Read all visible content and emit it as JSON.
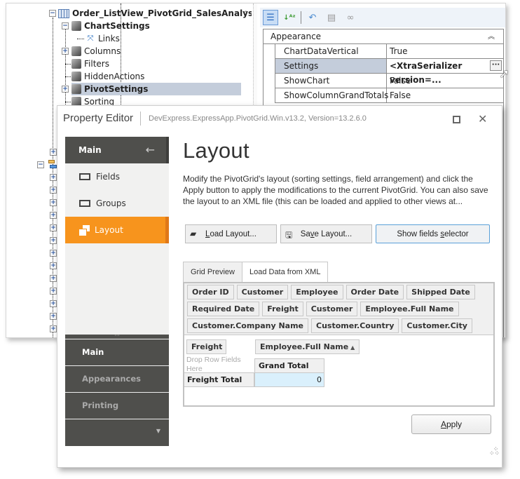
{
  "model_tree": {
    "nodes": [
      {
        "label": "Order_ListView_PivotGrid_SalesAnalysis",
        "bold": true,
        "icon": "listview-icon",
        "expander": "minus"
      },
      {
        "label": "ChartSettings",
        "bold": true,
        "icon": "cube-icon",
        "expander": "minus"
      },
      {
        "label": "Links",
        "bold": false,
        "icon": "links-icon",
        "expander": "none"
      },
      {
        "label": "Columns",
        "bold": false,
        "icon": "cube-icon",
        "expander": "plus"
      },
      {
        "label": "Filters",
        "bold": false,
        "icon": "cube-icon",
        "expander": "none"
      },
      {
        "label": "HiddenActions",
        "bold": false,
        "icon": "cube-icon",
        "expander": "none"
      },
      {
        "label": "PivotSettings",
        "bold": true,
        "icon": "cube-icon",
        "expander": "plus",
        "selected": true
      },
      {
        "label": "Sorting",
        "bold": false,
        "icon": "cube-icon",
        "expander": "none"
      }
    ],
    "collapsed_expanders_count": 15
  },
  "property_grid": {
    "toolbar": [
      "categorized-icon",
      "alphabetical-icon",
      "undo-icon",
      "reset-icon",
      "link-icon"
    ],
    "category": "Appearance",
    "rows": [
      {
        "name": "ChartDataVertical",
        "value": "True"
      },
      {
        "name": "Settings",
        "value": "<XtraSerializer version=...",
        "selected": true,
        "has_ellipsis": true
      },
      {
        "name": "ShowChart",
        "value": "False"
      },
      {
        "name": "ShowColumnGrandTotals",
        "value": "False"
      }
    ],
    "ellipsis_label": "···"
  },
  "dialog": {
    "title": "Property Editor",
    "subtitle": "DevExpress.ExpressApp.PivotGrid.Win.v13.2, Version=13.2.6.0",
    "nav": {
      "header": "Main",
      "items": [
        {
          "label": "Fields",
          "active": false
        },
        {
          "label": "Groups",
          "active": false
        },
        {
          "label": "Layout",
          "active": true
        }
      ],
      "groups": [
        {
          "label": "Main",
          "active": true
        },
        {
          "label": "Appearances",
          "active": false
        },
        {
          "label": "Printing",
          "active": false
        }
      ]
    },
    "page": {
      "title": "Layout",
      "description": "Modify the PivotGrid's layout (sorting settings, field arrangement) and click the Apply button to apply the modifications to the current PivotGrid. You can also save the layout to an XML file (this can be loaded and applied to other views at...",
      "buttons": {
        "load": {
          "pre": "",
          "key": "L",
          "post": "oad Layout..."
        },
        "save": {
          "pre": "Sa",
          "key": "v",
          "post": "e Layout..."
        },
        "show": {
          "pre": "Show fields ",
          "key": "s",
          "post": "elector"
        }
      },
      "tabs": [
        {
          "label": "Grid Preview",
          "active": false
        },
        {
          "label": "Load Data from XML",
          "active": true
        }
      ],
      "field_list": [
        "Order ID",
        "Customer",
        "Employee",
        "Order Date",
        "Shipped Date",
        "Required Date",
        "Freight",
        "Customer",
        "Employee.Full Name",
        "Customer.Company Name",
        "Customer.Country",
        "Customer.City"
      ],
      "pivot": {
        "data_field": "Freight",
        "column_field": "Employee.Full Name",
        "row_drop_hint": "Drop Row Fields Here",
        "grand_total_header": "Grand Total",
        "row_total_label": "Freight Total",
        "row_total_value": "0"
      }
    },
    "apply": {
      "key": "A",
      "post": "pply"
    }
  }
}
